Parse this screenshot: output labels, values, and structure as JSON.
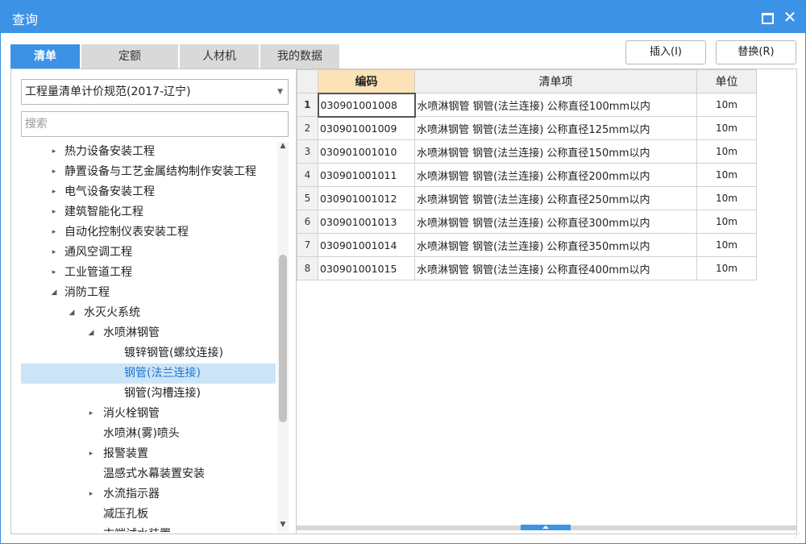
{
  "window": {
    "title": "查询"
  },
  "tabs": [
    {
      "label": "清单",
      "active": true
    },
    {
      "label": "定额",
      "active": false
    },
    {
      "label": "人材机",
      "active": false
    },
    {
      "label": "我的数据",
      "active": false
    }
  ],
  "buttons": {
    "insert": "插入(I)",
    "replace": "替换(R)"
  },
  "spec_combo": {
    "selected": "工程量清单计价规范(2017-辽宁)"
  },
  "search": {
    "placeholder": "搜索",
    "value": ""
  },
  "tree": [
    {
      "label": "热力设备安装工程",
      "level": 1,
      "toggle": "▸",
      "selected": false
    },
    {
      "label": "静置设备与工艺金属结构制作安装工程",
      "level": 1,
      "toggle": "▸",
      "selected": false
    },
    {
      "label": "电气设备安装工程",
      "level": 1,
      "toggle": "▸",
      "selected": false
    },
    {
      "label": "建筑智能化工程",
      "level": 1,
      "toggle": "▸",
      "selected": false
    },
    {
      "label": "自动化控制仪表安装工程",
      "level": 1,
      "toggle": "▸",
      "selected": false
    },
    {
      "label": "通风空调工程",
      "level": 1,
      "toggle": "▸",
      "selected": false
    },
    {
      "label": "工业管道工程",
      "level": 1,
      "toggle": "▸",
      "selected": false
    },
    {
      "label": "消防工程",
      "level": 1,
      "toggle": "◢",
      "selected": false
    },
    {
      "label": "水灭火系统",
      "level": 2,
      "toggle": "◢",
      "selected": false
    },
    {
      "label": "水喷淋钢管",
      "level": 3,
      "toggle": "◢",
      "selected": false
    },
    {
      "label": "镀锌钢管(螺纹连接)",
      "level": 4,
      "toggle": "",
      "selected": false
    },
    {
      "label": "钢管(法兰连接)",
      "level": 4,
      "toggle": "",
      "selected": true
    },
    {
      "label": "钢管(沟槽连接)",
      "level": 4,
      "toggle": "",
      "selected": false
    },
    {
      "label": "消火栓钢管",
      "level": 3,
      "toggle": "▸",
      "selected": false
    },
    {
      "label": "水喷淋(雾)喷头",
      "level": 3,
      "toggle": "",
      "selected": false
    },
    {
      "label": "报警装置",
      "level": 3,
      "toggle": "▸",
      "selected": false
    },
    {
      "label": "温感式水幕装置安装",
      "level": 3,
      "toggle": "",
      "selected": false
    },
    {
      "label": "水流指示器",
      "level": 3,
      "toggle": "▸",
      "selected": false
    },
    {
      "label": "减压孔板",
      "level": 3,
      "toggle": "",
      "selected": false
    },
    {
      "label": "末端试水装置",
      "level": 3,
      "toggle": "",
      "selected": false
    }
  ],
  "table": {
    "headers": {
      "code": "编码",
      "name": "清单项",
      "unit": "单位"
    },
    "rows": [
      {
        "n": "1",
        "code": "030901001008",
        "name": "水喷淋钢管 钢管(法兰连接) 公称直径100mm以内",
        "unit": "10m"
      },
      {
        "n": "2",
        "code": "030901001009",
        "name": "水喷淋钢管 钢管(法兰连接) 公称直径125mm以内",
        "unit": "10m"
      },
      {
        "n": "3",
        "code": "030901001010",
        "name": "水喷淋钢管 钢管(法兰连接) 公称直径150mm以内",
        "unit": "10m"
      },
      {
        "n": "4",
        "code": "030901001011",
        "name": "水喷淋钢管 钢管(法兰连接) 公称直径200mm以内",
        "unit": "10m"
      },
      {
        "n": "5",
        "code": "030901001012",
        "name": "水喷淋钢管 钢管(法兰连接) 公称直径250mm以内",
        "unit": "10m"
      },
      {
        "n": "6",
        "code": "030901001013",
        "name": "水喷淋钢管 钢管(法兰连接) 公称直径300mm以内",
        "unit": "10m"
      },
      {
        "n": "7",
        "code": "030901001014",
        "name": "水喷淋钢管 钢管(法兰连接) 公称直径350mm以内",
        "unit": "10m"
      },
      {
        "n": "8",
        "code": "030901001015",
        "name": "水喷淋钢管 钢管(法兰连接) 公称直径400mm以内",
        "unit": "10m"
      }
    ]
  },
  "colors": {
    "accent": "#3c93e6",
    "selected_row": "#cce4f7",
    "header_highlight": "#fde1b8"
  }
}
